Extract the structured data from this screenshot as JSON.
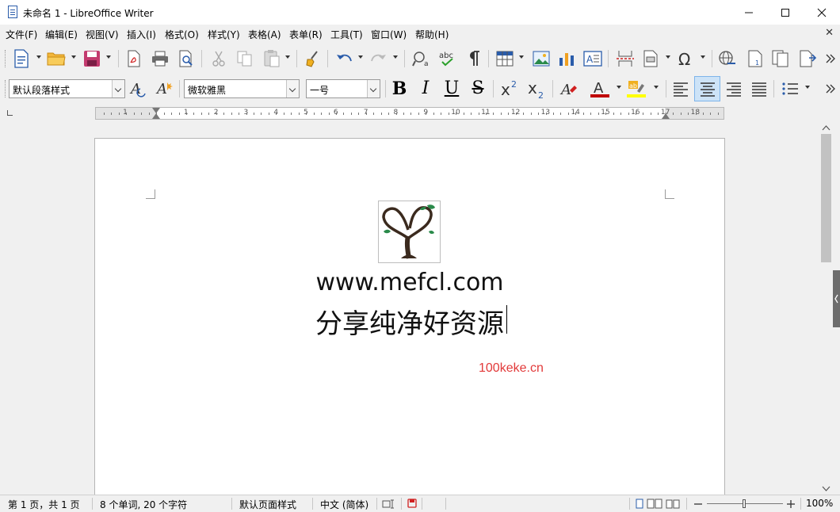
{
  "window": {
    "title": "未命名 1 - LibreOffice Writer",
    "minimize_label": "—",
    "maximize_label": "☐",
    "close_label": "✕"
  },
  "menu": {
    "items": [
      "文件(F)",
      "编辑(E)",
      "视图(V)",
      "插入(I)",
      "格式(O)",
      "样式(Y)",
      "表格(A)",
      "表单(R)",
      "工具(T)",
      "窗口(W)",
      "帮助(H)"
    ],
    "close_document": "✕"
  },
  "formatting": {
    "paragraph_style": "默认段落样式",
    "font_name": "微软雅黑",
    "font_size": "一号",
    "bold": "B",
    "italic": "I",
    "underline": "U",
    "strikethrough": "S"
  },
  "ruler": {
    "numbers": [
      "1",
      "1",
      "2",
      "3",
      "4",
      "5",
      "6",
      "7",
      "8",
      "9",
      "10",
      "11",
      "12",
      "13",
      "14",
      "15",
      "16",
      "17",
      "18"
    ]
  },
  "document": {
    "line1": "www.mefcl.com",
    "line2": "分享纯净好资源",
    "watermark": "100keke.cn"
  },
  "status": {
    "page": "第 1 页，共 1 页",
    "word_count": "8 个单词, 20 个字符",
    "page_style": "默认页面样式",
    "language": "中文 (简体)",
    "zoom": "100%"
  },
  "colors": {
    "accent": "#2a5caa",
    "font_color": "#c00000",
    "highlight_color": "#ffff00",
    "watermark": "#e23a3a"
  }
}
